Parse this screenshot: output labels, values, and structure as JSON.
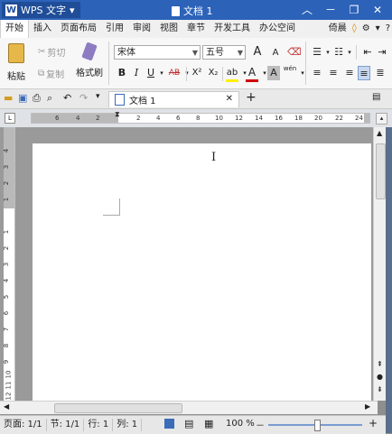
{
  "app": {
    "name": "WPS 文字",
    "dropdown": "▾",
    "doc_title": "文档 1",
    "minimize": "－",
    "restore": "❐",
    "close": "✕"
  },
  "menu": {
    "items": [
      "开始",
      "插入",
      "页面布局",
      "引用",
      "审阅",
      "视图",
      "章节",
      "开发工具",
      "办公空间"
    ],
    "right": [
      "倚晨",
      "◊",
      "⚙",
      "▾",
      "?"
    ]
  },
  "ribbon": {
    "paste": "粘贴",
    "cut": "剪切",
    "copy": "复制",
    "format_painter": "格式刷",
    "font_name": "宋体",
    "font_size": "五号",
    "grow_font": "A",
    "shrink_font": "A",
    "clear_format": "⌫",
    "bold": "B",
    "italic": "I",
    "underline": "U",
    "strike": "AB",
    "superscript": "X²",
    "subscript": "X₂",
    "highlight": "ab",
    "font_color": "A",
    "char_shading": "A",
    "phonetic": "wén"
  },
  "tabs": {
    "doc_tab": "文档 1",
    "close_tab": "✕",
    "new_tab": "+"
  },
  "ruler": {
    "h_ticks": [
      "6",
      "4",
      "2",
      "2",
      "4",
      "6",
      "8",
      "10",
      "12",
      "14",
      "16",
      "18",
      "20",
      "22",
      "24"
    ],
    "v_ticks": [
      "4",
      "3",
      "2",
      "1",
      "1",
      "2",
      "3",
      "4",
      "5",
      "6",
      "7",
      "8",
      "9",
      "10",
      "11",
      "12"
    ]
  },
  "status": {
    "page": "页面: 1/1",
    "section": "节: 1/1",
    "line": "行: 1",
    "column": "列: 1",
    "zoom": "100 %",
    "zoom_out": "－",
    "zoom_in": "+"
  },
  "colors": {
    "title_bar": "#2c62b8",
    "app_button": "#1f4d97",
    "font_color_swatch": "#d00000",
    "highlight_swatch": "#ffef00"
  }
}
